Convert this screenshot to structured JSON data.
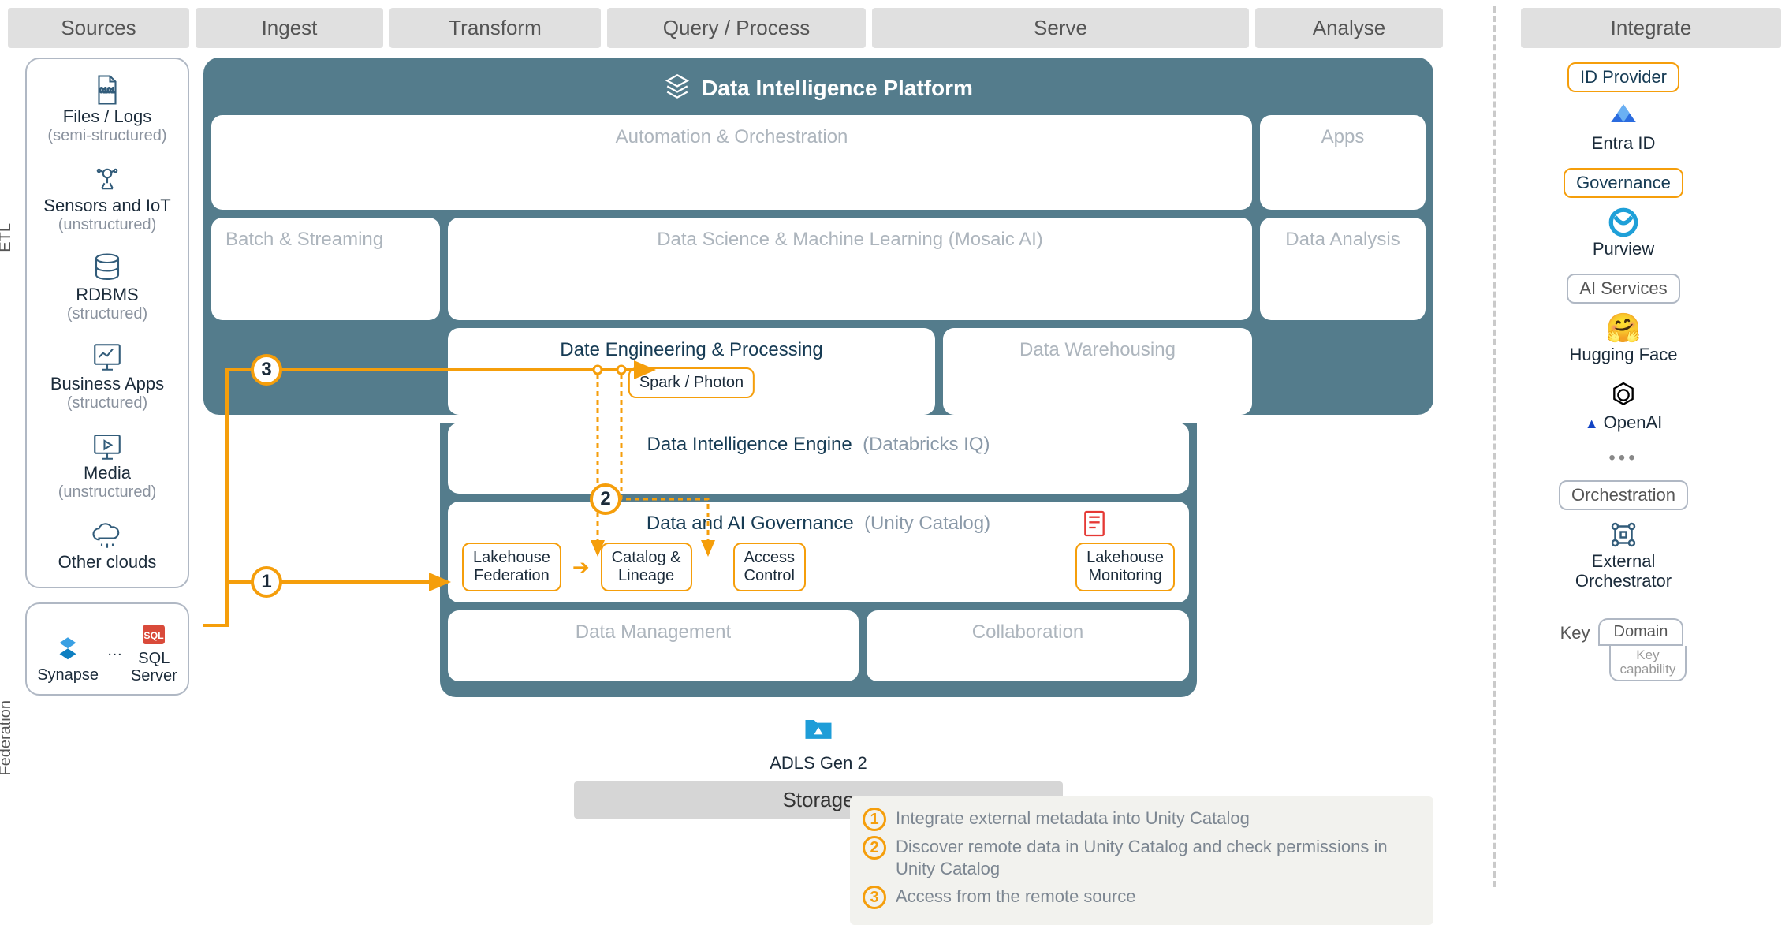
{
  "headers": {
    "sources": "Sources",
    "ingest": "Ingest",
    "transform": "Transform",
    "query": "Query / Process",
    "serve": "Serve",
    "analyse": "Analyse",
    "integrate": "Integrate"
  },
  "side_labels": {
    "etl": "ETL",
    "federation": "Federation"
  },
  "sources": [
    {
      "title": "Files / Logs",
      "sub": "(semi-structured)"
    },
    {
      "title": "Sensors and IoT",
      "sub": "(unstructured)"
    },
    {
      "title": "RDBMS",
      "sub": "(structured)"
    },
    {
      "title": "Business Apps",
      "sub": "(structured)"
    },
    {
      "title": "Media",
      "sub": "(unstructured)"
    },
    {
      "title": "Other clouds",
      "sub": ""
    }
  ],
  "federation": {
    "items": [
      "Synapse",
      "SQL Server"
    ],
    "ellipsis": "…"
  },
  "platform": {
    "title": "Data Intelligence Platform",
    "automation": "Automation & Orchestration",
    "apps": "Apps",
    "batch": "Batch & Streaming",
    "dsml": "Data Science & Machine Learning  (Mosaic AI)",
    "data_analysis": "Data Analysis",
    "engineering": "Date Engineering & Processing",
    "spark": "Spark / Photon",
    "warehousing": "Data Warehousing",
    "intel_engine": {
      "dark": "Data Intelligence Engine",
      "muted": "(Databricks IQ)"
    },
    "governance": {
      "title_dark": "Data and AI Governance",
      "title_muted": "(Unity Catalog)",
      "lakehouse_fed": "Lakehouse Federation",
      "catalog": "Catalog & Lineage",
      "access": "Access Control",
      "monitoring": "Lakehouse Monitoring"
    },
    "data_mgmt": "Data Management",
    "collab": "Collaboration"
  },
  "storage": {
    "label": "ADLS Gen 2",
    "title": "Storage"
  },
  "legend": {
    "1": "Integrate external metadata into Unity Catalog",
    "2": "Discover remote data in Unity Catalog and check permissions in Unity Catalog",
    "3": "Access from the remote source"
  },
  "integrate": {
    "id_provider": "ID Provider",
    "entra": "Entra ID",
    "governance": "Governance",
    "purview": "Purview",
    "ai_services": "AI Services",
    "hf": "Hugging Face",
    "openai": "OpenAI",
    "orchestration": "Orchestration",
    "ext_orch": "External Orchestrator"
  },
  "key": {
    "label": "Key",
    "domain": "Domain",
    "capability": "Key capability"
  }
}
